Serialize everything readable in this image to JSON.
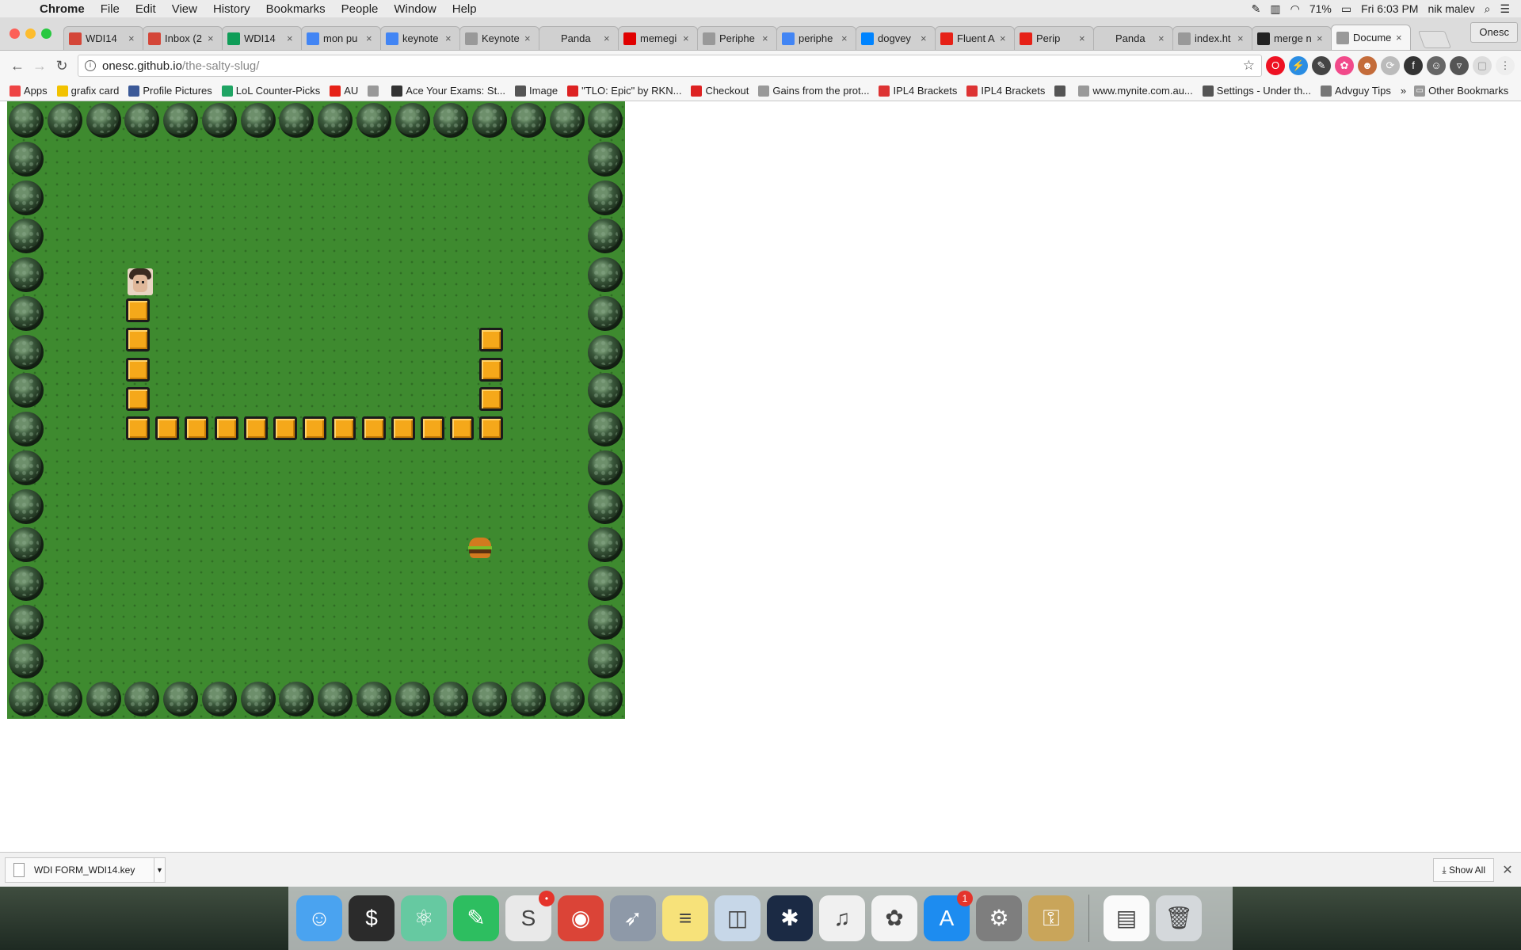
{
  "menubar": {
    "app": "Chrome",
    "items": [
      "File",
      "Edit",
      "View",
      "History",
      "Bookmarks",
      "People",
      "Window",
      "Help"
    ],
    "battery": "71%",
    "clock": "Fri 6:03 PM",
    "user": "nik  malev"
  },
  "tabs": [
    {
      "title": "WDI14",
      "icon": "gmail-icon",
      "color": "#d44638"
    },
    {
      "title": "Inbox (2",
      "icon": "gmail-icon",
      "color": "#d44638"
    },
    {
      "title": "WDI14",
      "icon": "sheets-icon",
      "color": "#0f9d58"
    },
    {
      "title": "mon pu",
      "icon": "google-icon",
      "color": "#4285f4"
    },
    {
      "title": "keynote",
      "icon": "google-icon",
      "color": "#4285f4"
    },
    {
      "title": "Keynote",
      "icon": "apple-icon",
      "color": "#999999"
    },
    {
      "title": "Panda",
      "icon": "",
      "color": ""
    },
    {
      "title": "memegi",
      "icon": "adobe-icon",
      "color": "#e00000"
    },
    {
      "title": "Periphe",
      "icon": "apple-icon",
      "color": "#999999"
    },
    {
      "title": "periphe",
      "icon": "google-icon",
      "color": "#4285f4"
    },
    {
      "title": "dogvey",
      "icon": "messenger-icon",
      "color": "#0084ff"
    },
    {
      "title": "Fluent A",
      "icon": "youtube-icon",
      "color": "#e62117"
    },
    {
      "title": "Perip",
      "icon": "youtube-icon",
      "color": "#e62117"
    },
    {
      "title": "Panda",
      "icon": "",
      "color": ""
    },
    {
      "title": "index.ht",
      "icon": "file-icon",
      "color": "#999999"
    },
    {
      "title": "merge n",
      "icon": "github-icon",
      "color": "#222222"
    },
    {
      "title": "Docume",
      "icon": "file-icon",
      "color": "#999999",
      "active": true
    }
  ],
  "profile_button": "Onesc",
  "address": {
    "host": "onesc.github.io",
    "path": "/the-salty-slug/"
  },
  "bookmarks": [
    {
      "label": "Apps",
      "icon": "apps-grid-icon",
      "color": "#e44"
    },
    {
      "label": "grafix card",
      "icon": "lemon-icon",
      "color": "#f2c200"
    },
    {
      "label": "Profile Pictures",
      "icon": "facebook-icon",
      "color": "#3b5998"
    },
    {
      "label": "LoL Counter-Picks",
      "icon": "drive-icon",
      "color": "#1fa463"
    },
    {
      "label": "AU",
      "icon": "youtube-icon",
      "color": "#e62117"
    },
    {
      "label": "",
      "icon": "page-icon",
      "color": "#999"
    },
    {
      "label": "Ace Your Exams: St...",
      "icon": "mustache-icon",
      "color": "#333"
    },
    {
      "label": "Image",
      "icon": "bug-icon",
      "color": "#555"
    },
    {
      "label": "\"TLO: Epic\" by RKN...",
      "icon": "genius-icon",
      "color": "#d22"
    },
    {
      "label": "Checkout",
      "icon": "adobe-icon",
      "color": "#d22"
    },
    {
      "label": "Gains from the prot...",
      "icon": "page-icon",
      "color": "#999"
    },
    {
      "label": "IPL4 Brackets",
      "icon": "ipl-icon",
      "color": "#d33"
    },
    {
      "label": "IPL4 Brackets",
      "icon": "ipl-icon",
      "color": "#d33"
    },
    {
      "label": "",
      "icon": "download-icon",
      "color": "#555"
    },
    {
      "label": "www.mynite.com.au...",
      "icon": "page-icon",
      "color": "#999"
    },
    {
      "label": "Settings - Under th...",
      "icon": "gear-icon",
      "color": "#555"
    },
    {
      "label": "Advguy Tips",
      "icon": "page-icon",
      "color": "#777"
    }
  ],
  "other_bookmarks": "Other Bookmarks",
  "game": {
    "grid_size": 16,
    "head_cell": [
      3,
      5
    ],
    "body_cells": [
      [
        3,
        6
      ],
      [
        3,
        7
      ],
      [
        3,
        8
      ],
      [
        3,
        9
      ],
      [
        3,
        10
      ],
      [
        4,
        10
      ],
      [
        5,
        10
      ],
      [
        6,
        10
      ],
      [
        7,
        10
      ],
      [
        8,
        10
      ],
      [
        9,
        10
      ],
      [
        10,
        10
      ],
      [
        11,
        10
      ],
      [
        12,
        10
      ],
      [
        13,
        10
      ],
      [
        14,
        10
      ],
      [
        15,
        10
      ],
      [
        15,
        9
      ],
      [
        15,
        8
      ],
      [
        15,
        7
      ]
    ],
    "food_cell": [
      14.6,
      14.1
    ],
    "colors": {
      "grass": "#3e8a2f",
      "segment": "#f5a81a"
    }
  },
  "download": {
    "filename": "WDI FORM_WDI14.key",
    "show_all": "Show All"
  },
  "dock": [
    {
      "name": "finder-icon",
      "color": "#4aa3f0",
      "glyph": "☺"
    },
    {
      "name": "terminal-icon",
      "color": "#2b2b2b",
      "glyph": "$"
    },
    {
      "name": "atom-icon",
      "color": "#66c9a1",
      "glyph": "⚛"
    },
    {
      "name": "evernote-icon",
      "color": "#2dbe60",
      "glyph": "✎"
    },
    {
      "name": "slack-icon",
      "color": "#e9e9e9",
      "glyph": "S",
      "badge": "•"
    },
    {
      "name": "chrome-icon",
      "color": "#db4437",
      "glyph": "◉"
    },
    {
      "name": "launchpad-icon",
      "color": "#8e99a8",
      "glyph": "➶"
    },
    {
      "name": "notes-icon",
      "color": "#f7e27a",
      "glyph": "≡"
    },
    {
      "name": "preview-icon",
      "color": "#c7d7e8",
      "glyph": "◫"
    },
    {
      "name": "battlenet-icon",
      "color": "#1b2a44",
      "glyph": "✱"
    },
    {
      "name": "itunes-icon",
      "color": "#f0f0f0",
      "glyph": "♫"
    },
    {
      "name": "photos-icon",
      "color": "#f3f3f3",
      "glyph": "✿"
    },
    {
      "name": "app-store-icon",
      "color": "#1d8cf0",
      "glyph": "A",
      "badge": "1"
    },
    {
      "name": "system-preferences-icon",
      "color": "#7e7e7e",
      "glyph": "⚙"
    },
    {
      "name": "keychain-icon",
      "color": "#c9a55a",
      "glyph": "⚿"
    },
    {
      "name": "document-stack-icon",
      "color": "#fafafa",
      "glyph": "▤"
    },
    {
      "name": "trash-icon",
      "color": "#d4d8db",
      "glyph": "🗑"
    }
  ]
}
